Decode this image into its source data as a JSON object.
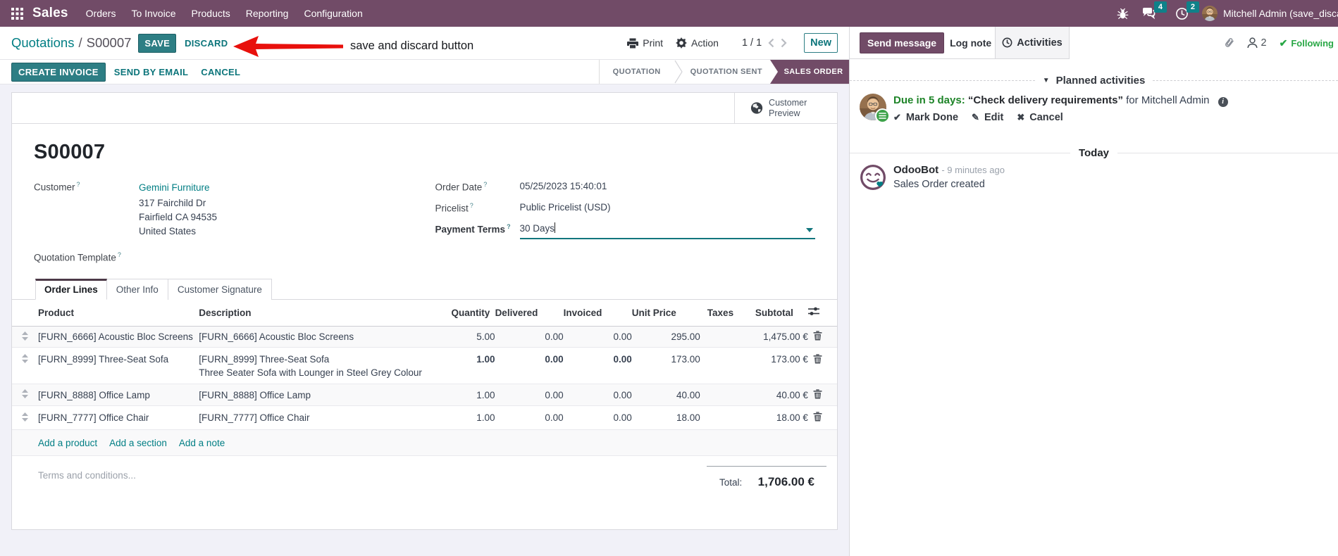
{
  "navbar": {
    "brand": "Sales",
    "menus": [
      "Orders",
      "To Invoice",
      "Products",
      "Reporting",
      "Configuration"
    ],
    "message_count": "4",
    "activity_count": "2",
    "user_name": "Mitchell Admin (save_discard"
  },
  "control_panel": {
    "breadcrumb_parent": "Quotations",
    "breadcrumb_separator": "/",
    "breadcrumb_current": "S00007",
    "save_label": "SAVE",
    "discard_label": "DISCARD",
    "annotation_text": "save and discard button",
    "print_label": "Print",
    "action_label": "Action",
    "pager": "1 / 1",
    "new_label": "New"
  },
  "statusbar": {
    "create_invoice_label": "CREATE INVOICE",
    "send_by_email_label": "SEND BY EMAIL",
    "cancel_label": "CANCEL",
    "steps": [
      {
        "label": "QUOTATION",
        "active": false
      },
      {
        "label": "QUOTATION SENT",
        "active": false
      },
      {
        "label": "SALES ORDER",
        "active": true
      }
    ]
  },
  "form": {
    "customer_preview_label": "Customer Preview",
    "title": "S00007",
    "customer_label": "Customer",
    "customer_name": "Gemini Furniture",
    "address_lines": [
      "317 Fairchild Dr",
      "Fairfield CA 94535",
      "United States"
    ],
    "quotation_template_label": "Quotation Template",
    "order_date_label": "Order Date",
    "order_date_value": "05/25/2023 15:40:01",
    "pricelist_label": "Pricelist",
    "pricelist_value": "Public Pricelist (USD)",
    "payment_terms_label": "Payment Terms",
    "payment_terms_value": "30 Days"
  },
  "tabs": [
    "Order Lines",
    "Other Info",
    "Customer Signature"
  ],
  "order_lines": {
    "columns": {
      "product": "Product",
      "description": "Description",
      "quantity": "Quantity",
      "delivered": "Delivered",
      "invoiced": "Invoiced",
      "unit_price": "Unit Price",
      "taxes": "Taxes",
      "subtotal": "Subtotal"
    },
    "rows": [
      {
        "product": "[FURN_6666] Acoustic Bloc Screens",
        "description": "[FURN_6666] Acoustic Bloc Screens",
        "description2": "",
        "quantity": "5.00",
        "delivered": "0.00",
        "invoiced": "0.00",
        "unit_price": "295.00",
        "taxes": "",
        "subtotal": "1,475.00 €"
      },
      {
        "product": "[FURN_8999] Three-Seat Sofa",
        "description": "[FURN_8999] Three-Seat Sofa",
        "description2": "Three Seater Sofa with Lounger in Steel Grey Colour",
        "quantity": "1.00",
        "delivered": "0.00",
        "invoiced": "0.00",
        "unit_price": "173.00",
        "taxes": "",
        "subtotal": "173.00 €"
      },
      {
        "product": "[FURN_8888] Office Lamp",
        "description": "[FURN_8888] Office Lamp",
        "description2": "",
        "quantity": "1.00",
        "delivered": "0.00",
        "invoiced": "0.00",
        "unit_price": "40.00",
        "taxes": "",
        "subtotal": "40.00 €"
      },
      {
        "product": "[FURN_7777] Office Chair",
        "description": "[FURN_7777] Office Chair",
        "description2": "",
        "quantity": "1.00",
        "delivered": "0.00",
        "invoiced": "0.00",
        "unit_price": "18.00",
        "taxes": "",
        "subtotal": "18.00 €"
      }
    ],
    "add_links": [
      "Add a product",
      "Add a section",
      "Add a note"
    ],
    "terms_placeholder": "Terms and conditions...",
    "total_label": "Total:",
    "total_value": "1,706.00 €"
  },
  "chatter": {
    "send_message_label": "Send message",
    "log_note_label": "Log note",
    "activities_label": "Activities",
    "followers_count": "2",
    "following_label": "Following",
    "planned_activities_label": "Planned activities",
    "activity": {
      "due": "Due in 5 days:",
      "title": "“Check delivery requirements”",
      "assignee": "for Mitchell Admin",
      "mark_done_label": "Mark Done",
      "edit_label": "Edit",
      "cancel_label": "Cancel"
    },
    "date_divider": "Today",
    "message": {
      "author": "OdooBot",
      "time": "- 9 minutes ago",
      "body": "Sales Order created"
    }
  },
  "icons": {
    "check": "✔",
    "pencil": "✎",
    "cross": "✖",
    "triangle_down": "▼",
    "info": "i"
  },
  "colors": {
    "brand_purple": "#714B67",
    "accent_teal": "#017e84",
    "button_teal": "#2d7e84",
    "success_green": "#28a745",
    "due_green": "#1e8428",
    "annotation_red": "#e8100c",
    "page_background": "#f1f1f8"
  }
}
